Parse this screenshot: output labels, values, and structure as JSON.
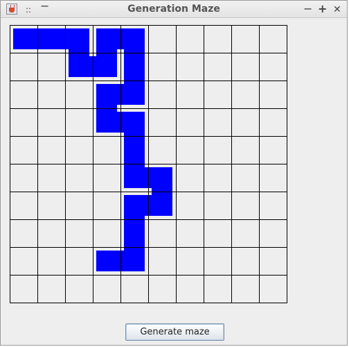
{
  "window": {
    "title": "Generation Maze",
    "icons": [
      "java-cup-icon",
      "menu-dots-icon",
      "minimize-icon",
      "maximize-icon",
      "close-icon"
    ],
    "title_buttons": {
      "left_dots": "::",
      "left_minus": "−",
      "minimize": "−",
      "maximize": "+",
      "close": "✕"
    }
  },
  "maze": {
    "rows": 10,
    "cols": 10,
    "fill_color": "#0000ff",
    "grid_color": "#000000",
    "background": "#eeeeee",
    "path": [
      [
        0,
        0
      ],
      [
        0,
        1
      ],
      [
        0,
        2
      ],
      [
        1,
        2
      ],
      [
        1,
        3
      ],
      [
        0,
        3
      ],
      [
        0,
        4
      ],
      [
        1,
        4
      ],
      [
        2,
        4
      ],
      [
        2,
        3
      ],
      [
        3,
        3
      ],
      [
        3,
        4
      ],
      [
        4,
        4
      ],
      [
        5,
        4
      ],
      [
        5,
        5
      ],
      [
        6,
        5
      ],
      [
        6,
        4
      ],
      [
        7,
        4
      ],
      [
        8,
        4
      ],
      [
        8,
        3
      ]
    ]
  },
  "button": {
    "label": "Generate maze"
  }
}
